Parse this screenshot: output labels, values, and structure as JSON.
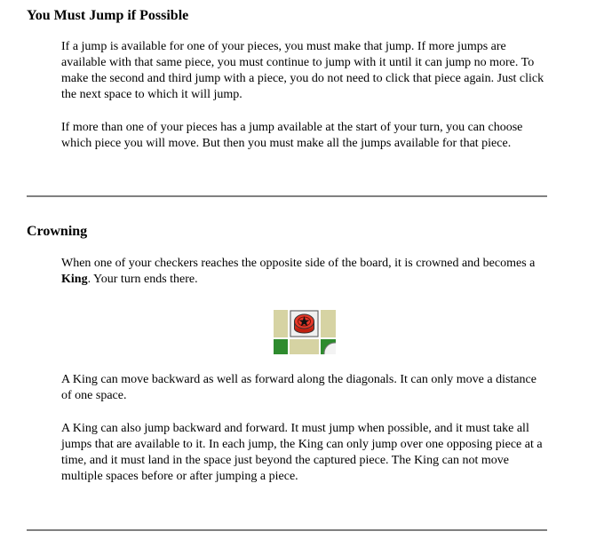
{
  "section1": {
    "heading": "You Must Jump if Possible",
    "para1": "If a jump is available for one of your pieces, you must make that jump. If more jumps are available with that same piece, you must continue to jump with it until it can jump no more. To make the second and third jump with a piece, you do not need to click that piece again. Just click the next space to which it will jump.",
    "para2": "If more than one of your pieces has a jump available at the start of your turn, you can choose which piece you will move. But then you must make all the jumps available for that piece."
  },
  "section2": {
    "heading": "Crowning",
    "para1_pre": "When one of your checkers reaches the opposite side of the board, it is crowned and becomes a ",
    "para1_bold": "King",
    "para1_post": ". Your turn ends there.",
    "para2": "A King can move backward as well as forward along the diagonals. It can only move a distance of one space.",
    "para3": "A King can also jump backward and forward. It must jump when possible, and it must take all jumps that are available to it. In each jump, the King can only jump over one opposing piece at a time, and it must land in the space just beyond the captured piece. The King can not move multiple spaces before or after jumping a piece."
  },
  "colors": {
    "light_square": "#d6d3a3",
    "dark_square": "#2e8b2e",
    "king_piece": "#e03020",
    "rule": "#808080"
  }
}
